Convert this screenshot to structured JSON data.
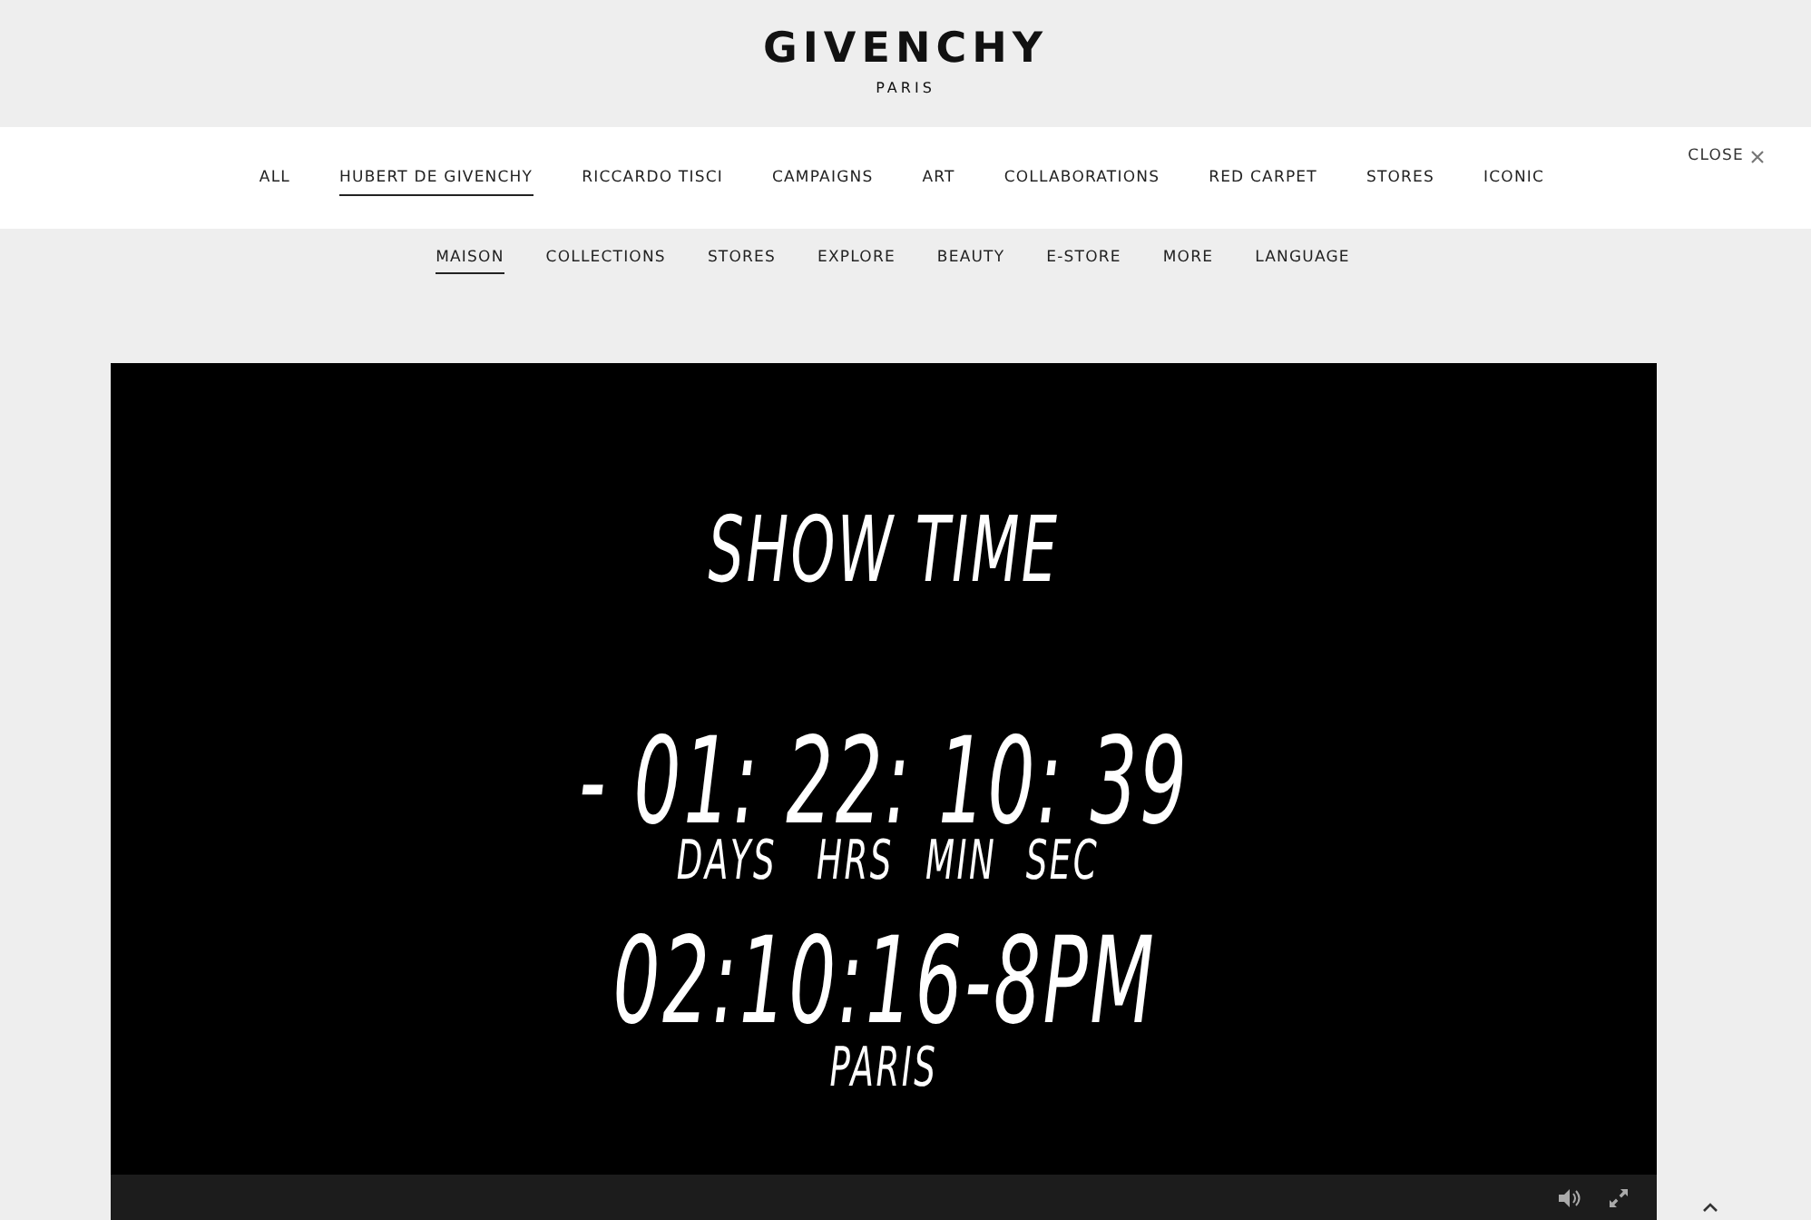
{
  "header": {
    "logo": "GIVENCHY",
    "logo_sub": "PARIS"
  },
  "nav": {
    "items": [
      {
        "label": "ALL",
        "selected": false
      },
      {
        "label": "HUBERT DE GIVENCHY",
        "selected": true
      },
      {
        "label": "RICCARDO TISCI",
        "selected": false
      },
      {
        "label": "CAMPAIGNS",
        "selected": false
      },
      {
        "label": "ART",
        "selected": false
      },
      {
        "label": "COLLABORATIONS",
        "selected": false
      },
      {
        "label": "RED CARPET",
        "selected": false
      },
      {
        "label": "STORES",
        "selected": false
      },
      {
        "label": "ICONIC",
        "selected": false
      }
    ],
    "close": "CLOSE"
  },
  "subnav": {
    "items": [
      {
        "label": "MAISON",
        "selected": true
      },
      {
        "label": "COLLECTIONS",
        "selected": false
      },
      {
        "label": "STORES",
        "selected": false
      },
      {
        "label": "EXPLORE",
        "selected": false
      },
      {
        "label": "BEAUTY",
        "selected": false
      },
      {
        "label": "E-STORE",
        "selected": false
      },
      {
        "label": "MORE",
        "selected": false
      },
      {
        "label": "LANGUAGE",
        "selected": false
      }
    ]
  },
  "video": {
    "title": "SHOW TIME",
    "countdown": "- 01: 22: 10: 39",
    "units": [
      "DAYS",
      "HRS",
      "MIN",
      "SEC"
    ],
    "time": "02:10:16-8PM",
    "city": "PARIS"
  }
}
